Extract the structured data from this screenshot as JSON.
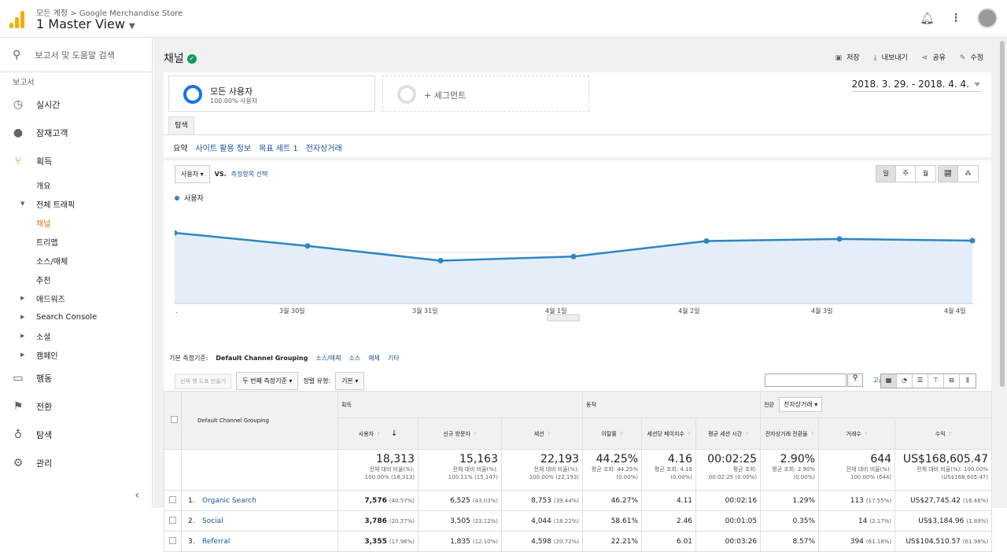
{
  "topbar": {
    "breadcrumb": "모든 계정 > Google Merchandise Store",
    "view": "1 Master View"
  },
  "sidebar": {
    "search": "보고서 및 도움말 검색",
    "section": "보고서",
    "items": [
      {
        "label": "실시간"
      },
      {
        "label": "잠재고객"
      },
      {
        "label": "획득"
      }
    ],
    "sub": [
      {
        "label": "개요"
      },
      {
        "label": "전체 트래픽"
      },
      {
        "label": "채널"
      },
      {
        "label": "트리맵"
      },
      {
        "label": "소스/매체"
      },
      {
        "label": "추천"
      },
      {
        "label": "애드워즈"
      },
      {
        "label": "Search Console"
      },
      {
        "label": "소셜"
      },
      {
        "label": "캠페인"
      }
    ],
    "bottom": [
      {
        "label": "행동"
      },
      {
        "label": "전환"
      },
      {
        "label": "탐색"
      },
      {
        "label": "관리"
      }
    ]
  },
  "header": {
    "title": "채널",
    "actions": [
      "저장",
      "내보내기",
      "공유",
      "수정"
    ]
  },
  "segments": {
    "seg1_title": "모든 사용자",
    "seg1_sub": "100.00% 사용자",
    "seg2_title": "+ 세그먼트"
  },
  "date_range": "2018. 3. 29. - 2018. 4. 4.",
  "tab": "탐색",
  "subtabs": [
    "요약",
    "사이트 활용 정보",
    "목표 세트 1",
    "전자상거래"
  ],
  "controls": {
    "metric": "사용자",
    "vs": "VS.",
    "select_metric": "측정항목 선택",
    "granularity": [
      "일",
      "주",
      "월"
    ]
  },
  "chart_data": {
    "type": "area",
    "series": [
      {
        "name": "사용자",
        "values": [
          3460,
          2820,
          2100,
          2300,
          3060,
          3160,
          3080
        ]
      }
    ],
    "x": [
      "...",
      "3월 30일",
      "3월 31일",
      "4월 1일",
      "4월 2일",
      "4월 3일",
      "4월 4일"
    ],
    "yticks": [
      "5,000",
      "2,500"
    ],
    "ylim": [
      0,
      5000
    ],
    "color": "#2e86c1",
    "fill": "#e4eef9"
  },
  "primary_dim": {
    "label": "기본 측정기준:",
    "current": "Default Channel Grouping",
    "others": [
      "소스/매체",
      "소스",
      "매체",
      "기타"
    ]
  },
  "table_tools": {
    "create_btn": "선택 행 도표 만들기",
    "second_dim": "두 번째 측정기준",
    "sort_label": "정렬 유형:",
    "sort_value": "기본",
    "advanced": "고급"
  },
  "table": {
    "dim_header": "Default Channel Grouping",
    "groups": [
      "획득",
      "동작",
      "전환"
    ],
    "conv_select": "전자상거래",
    "columns": [
      "사용자",
      "신규 방문자",
      "세션",
      "이탈률",
      "세션당 페이지수",
      "평균 세션 시간",
      "전자상거래 전환율",
      "거래수",
      "수익"
    ],
    "totals": [
      {
        "big": "18,313",
        "sm1": "전체 대비 비율(%):",
        "sm2": "100.00% (18,313)"
      },
      {
        "big": "15,163",
        "sm1": "전체 대비 비율(%):",
        "sm2": "100.11% (15,147)"
      },
      {
        "big": "22,193",
        "sm1": "전체 대비 비율(%):",
        "sm2": "100.00% (22,193)"
      },
      {
        "big": "44.25%",
        "sm1": "평균 조회: 44.25%",
        "sm2": "(0.00%)"
      },
      {
        "big": "4.16",
        "sm1": "평균 조회: 4.16",
        "sm2": "(0.00%)"
      },
      {
        "big": "00:02:25",
        "sm1": "평균 조회:",
        "sm2": "00:02:25 (0.00%)"
      },
      {
        "big": "2.90%",
        "sm1": "평균 조회: 2.90%",
        "sm2": "(0.00%)"
      },
      {
        "big": "644",
        "sm1": "전체 대비 비율(%):",
        "sm2": "100.00% (644)"
      },
      {
        "big": "US$168,605.47",
        "sm1": "전체 대비 비율(%): 100.00%",
        "sm2": "(US$168,605.47)"
      }
    ],
    "rows": [
      {
        "n": "1.",
        "name": "Organic Search",
        "users": "7,576",
        "users_pct": "(40.57%)",
        "new": "6,525",
        "new_pct": "(43.03%)",
        "sess": "8,753",
        "sess_pct": "(39.44%)",
        "bounce": "46.27%",
        "pps": "4.11",
        "dur": "00:02:16",
        "conv": "1.29%",
        "tx": "113",
        "tx_pct": "(17.55%)",
        "rev": "US$27,745.42",
        "rev_pct": "(16.46%)"
      },
      {
        "n": "2.",
        "name": "Social",
        "users": "3,786",
        "users_pct": "(20.27%)",
        "new": "3,505",
        "new_pct": "(23.12%)",
        "sess": "4,044",
        "sess_pct": "(18.22%)",
        "bounce": "58.61%",
        "pps": "2.46",
        "dur": "00:01:05",
        "conv": "0.35%",
        "tx": "14",
        "tx_pct": "(2.17%)",
        "rev": "US$3,184.96",
        "rev_pct": "(1.89%)"
      },
      {
        "n": "3.",
        "name": "Referral",
        "users": "3,355",
        "users_pct": "(17.96%)",
        "new": "1,835",
        "new_pct": "(12.10%)",
        "sess": "4,598",
        "sess_pct": "(20.72%)",
        "bounce": "22.21%",
        "pps": "6.01",
        "dur": "00:03:26",
        "conv": "8.57%",
        "tx": "394",
        "tx_pct": "(61.18%)",
        "rev": "US$104,510.57",
        "rev_pct": "(61.98%)"
      }
    ]
  }
}
